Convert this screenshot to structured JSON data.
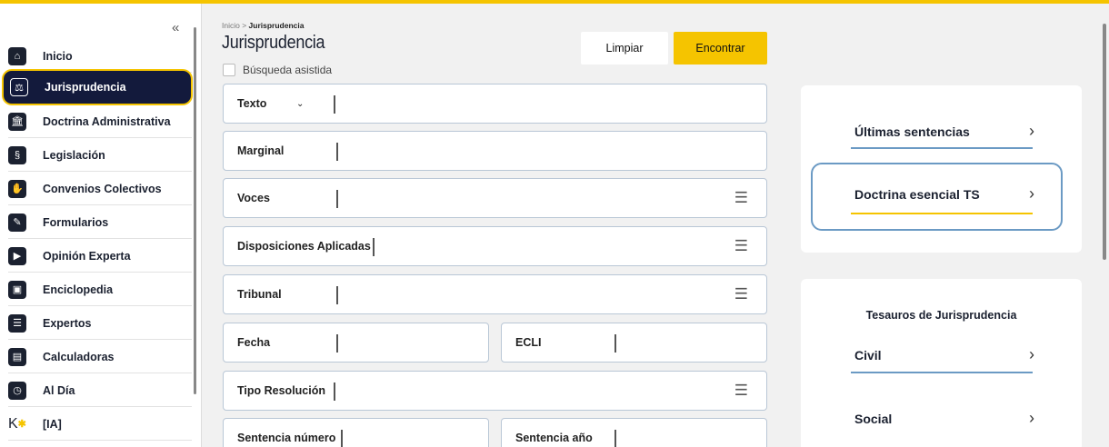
{
  "colors": {
    "accent": "#f5c400",
    "navy": "#131a3c",
    "link_underline": "#6b9ac4"
  },
  "sidebar": {
    "collapse_icon": "«",
    "items": [
      {
        "label": "Inicio",
        "icon": "home-icon",
        "glyph": "⌂"
      },
      {
        "label": "Jurisprudencia",
        "icon": "gavel-icon",
        "glyph": "⚖"
      },
      {
        "label": "Doctrina Administrativa",
        "icon": "building-icon",
        "glyph": "🏛"
      },
      {
        "label": "Legislación",
        "icon": "scales-icon",
        "glyph": "§"
      },
      {
        "label": "Convenios Colectivos",
        "icon": "handshake-icon",
        "glyph": "✋"
      },
      {
        "label": "Formularios",
        "icon": "form-edit-icon",
        "glyph": "✎"
      },
      {
        "label": "Opinión Experta",
        "icon": "expert-opinion-icon",
        "glyph": "▶"
      },
      {
        "label": "Enciclopedia",
        "icon": "encyclopedia-icon",
        "glyph": "▣"
      },
      {
        "label": "Expertos",
        "icon": "list-icon",
        "glyph": "☰"
      },
      {
        "label": "Calculadoras",
        "icon": "calculator-icon",
        "glyph": "▤"
      },
      {
        "label": "Al Día",
        "icon": "clock-icon",
        "glyph": "◷"
      },
      {
        "label": "[IA]",
        "icon": "ai-logo-icon",
        "glyph": "K"
      }
    ]
  },
  "main": {
    "breadcrumb_home": "Inicio",
    "breadcrumb_sep": " > ",
    "breadcrumb_current": "Jurisprudencia",
    "title": "Jurisprudencia",
    "assisted_search_label": "Búsqueda asistida",
    "clear_label": "Limpiar",
    "find_label": "Encontrar",
    "fields": {
      "texto": "Texto",
      "marginal": "Marginal",
      "voces": "Voces",
      "disposiciones": "Disposiciones Aplicadas",
      "tribunal": "Tribunal",
      "fecha": "Fecha",
      "ecli": "ECLI",
      "tipo_resolucion": "Tipo Resolución",
      "sentencia_numero": "Sentencia número",
      "sentencia_anio": "Sentencia año"
    }
  },
  "right": {
    "ultimas": "Últimas sentencias",
    "doctrina": "Doctrina esencial TS",
    "tesauros_title": "Tesauros de Jurisprudencia",
    "civil": "Civil",
    "social": "Social",
    "arrow": "›"
  }
}
